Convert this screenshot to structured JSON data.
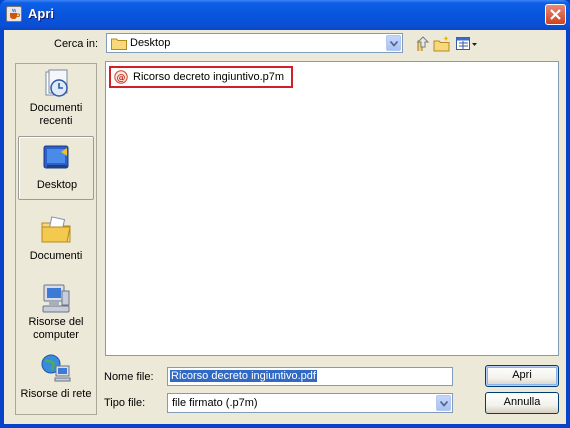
{
  "window": {
    "title": "Apri",
    "icons": {
      "app": "java-cup-icon",
      "close": "close-icon"
    }
  },
  "toolbar": {
    "look_in_label": "Cerca in:",
    "look_in_value": "Desktop",
    "look_in_icon": "folder-icon",
    "buttons": [
      "up-one-level-icon",
      "new-folder-icon",
      "view-menu-icon"
    ]
  },
  "places": [
    {
      "label": "Documenti recenti",
      "icon": "recent-documents-icon",
      "selected": false
    },
    {
      "label": "Desktop",
      "icon": "desktop-icon",
      "selected": true
    },
    {
      "label": "Documenti",
      "icon": "documents-folder-icon",
      "selected": false
    },
    {
      "label": "Risorse del computer",
      "icon": "my-computer-icon",
      "selected": false
    },
    {
      "label": "Risorse di rete",
      "icon": "network-icon",
      "selected": false
    }
  ],
  "files": [
    {
      "name": "Ricorso decreto ingiuntivo.p7m",
      "icon": "signed-file-icon",
      "highlighted": true
    }
  ],
  "filename": {
    "label": "Nome file:",
    "value": "Ricorso decreto ingiuntivo.pdf"
  },
  "filetype": {
    "label": "Tipo file:",
    "value": "file firmato (.p7m)"
  },
  "buttons": {
    "open": "Apri",
    "cancel": "Annulla"
  },
  "colors": {
    "title_bar": "#0855dd",
    "dialog_bg": "#ece9d8",
    "highlight_box": "#d0202a",
    "selection": "#316ac5"
  }
}
